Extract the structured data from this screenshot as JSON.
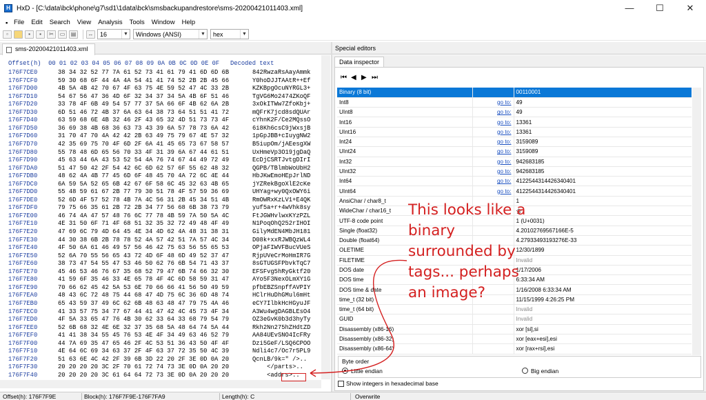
{
  "window": {
    "title": "HxD - [C:\\data\\bck\\phone\\g7\\sd1\\1data\\bck\\smsbackupandrestore\\sms-20200421011403.xml]",
    "app_icon_letter": "H",
    "minimize_glyph": "—",
    "maximize_glyph": "☐",
    "close_glyph": "✕"
  },
  "menu": [
    "File",
    "Edit",
    "Search",
    "View",
    "Analysis",
    "Tools",
    "Window",
    "Help"
  ],
  "toolbar": {
    "bytes_per_row": "16",
    "charset": "Windows (ANSI)",
    "offset_base": "hex"
  },
  "editor": {
    "tab_label": "sms-20200421011403.xml",
    "header": "Offset(h)  00 01 02 03 04 05 06 07 08 09 0A 0B 0C 0D 0E 0F   Decoded text",
    "rows": [
      {
        "offset": "176F7CE0",
        "bytes": "38 34 32 52 77 7A 61 52 73 41 61 79 41 6D 6D 6B",
        "text": "842RwzaRsAayAmmk"
      },
      {
        "offset": "176F7CF0",
        "bytes": "59 30 68 6F 44 4A 4A 54 41 41 74 52 2B 2B 45 66",
        "text": "Y0hoDJJTAAtR++Ef"
      },
      {
        "offset": "176F7D00",
        "bytes": "4B 5A 4B 42 70 67 4F 63 75 4E 59 52 47 4C 33 2B",
        "text": "KZKBpgOcuNYRGL3+"
      },
      {
        "offset": "176F7D10",
        "bytes": "54 67 56 47 36 4D 6F 32 34 37 34 5A 4B 6F 51 46",
        "text": "TgVG6Mo2474ZKoQF"
      },
      {
        "offset": "176F7D20",
        "bytes": "33 78 4F 6B 49 54 57 77 37 5A 66 6F 4B 62 6A 2B",
        "text": "3xOkITWw7ZfoKbj+"
      },
      {
        "offset": "176F7D30",
        "bytes": "6D 51 46 72 4B 37 6A 63 64 38 73 64 51 51 41 72",
        "text": "mQFrK7jcd8sdQUAr"
      },
      {
        "offset": "176F7D40",
        "bytes": "63 59 68 6E 4B 32 46 2F 43 65 32 4D 51 73 73 4F",
        "text": "cYhnK2F/Ce2MQssO"
      },
      {
        "offset": "176F7D50",
        "bytes": "36 69 38 4B 68 36 63 73 43 39 6A 57 78 73 6A 42",
        "text": "6i8Kh6csC9jWxsjB"
      },
      {
        "offset": "176F7D60",
        "bytes": "31 70 47 70 4A 42 42 2B 63 49 75 79 67 4E 57 32",
        "text": "1pGpJBB+cIuygNW2"
      },
      {
        "offset": "176F7D70",
        "bytes": "42 35 69 75 70 4F 6D 2F 6A 41 45 65 73 67 58 57",
        "text": "B5iupOm/jAEesgXW"
      },
      {
        "offset": "176F7D80",
        "bytes": "55 78 48 6D 65 56 70 33 4F 31 39 6A 67 44 61 51",
        "text": "UxHmeVp3O19jgDaQ"
      },
      {
        "offset": "176F7D90",
        "bytes": "45 63 44 6A 43 53 52 54 4A 76 74 67 44 49 72 49",
        "text": "EcDjCSRTJvtgDIrI"
      },
      {
        "offset": "176F7DA0",
        "bytes": "51 47 50 42 2F 54 42 6C 6D 62 57 6F 55 62 48 32",
        "text": "QGPB/TBlmbWoUbH2"
      },
      {
        "offset": "176F7DB0",
        "bytes": "48 62 4A 4B 77 45 6D 6F 48 45 70 4A 72 6C 4E 44",
        "text": "HbJKwEmoHEpJrlND"
      },
      {
        "offset": "176F7DC0",
        "bytes": "6A 59 5A 52 65 6B 42 67 6F 58 6C 45 32 63 4B 65",
        "text": "jYZRekBgoXlE2cKe"
      },
      {
        "offset": "176F7DD0",
        "bytes": "55 48 59 61 67 2B 77 79 30 51 78 4F 57 59 36 69",
        "text": "UHYag+wy0QxOWY6i"
      },
      {
        "offset": "176F7DE0",
        "bytes": "52 6D 4F 57 52 78 4B 7A 4C 56 31 2B 45 34 51 4B",
        "text": "RmOWRxKzLV1+E4QK"
      },
      {
        "offset": "176F7DF0",
        "bytes": "79 75 66 35 61 2B 72 2B 34 77 56 68 6B 38 73 79",
        "text": "yuf5a+r+4wVhk8sy"
      },
      {
        "offset": "176F7E00",
        "bytes": "46 74 4A 47 57 48 76 6C 77 78 4B 59 7A 50 5A 4C",
        "text": "FtJGWHvlwxKYzPZL"
      },
      {
        "offset": "176F7E10",
        "bytes": "4E 31 50 6F 71 4F 68 51 32 35 32 72 49 48 4F 49",
        "text": "N1PoqOhQ252rIHOI"
      },
      {
        "offset": "176F7E20",
        "bytes": "47 69 6C 79 4D 64 45 4E 34 4D 62 4A 48 31 38 31",
        "text": "GilyMdEN4MbJH181"
      },
      {
        "offset": "176F7E30",
        "bytes": "44 30 38 6B 2B 78 78 52 4A 57 42 51 7A 57 4C 34",
        "text": "D08k+xxRJWBQzWL4"
      },
      {
        "offset": "176F7E40",
        "bytes": "4F 50 6A 61 46 49 57 56 46 42 75 63 56 55 65 53",
        "text": "OPjaFIWVFBucVUeS"
      },
      {
        "offset": "176F7E50",
        "bytes": "52 6A 70 55 56 65 43 72 4D 6F 48 6D 49 52 37 47",
        "text": "RjpUVeCrMoHmIR7G"
      },
      {
        "offset": "176F7E60",
        "bytes": "38 73 47 54 55 47 53 46 50 62 76 6B 54 71 43 37",
        "text": "8sGTUGSFPbvkTqC7"
      },
      {
        "offset": "176F7E70",
        "bytes": "45 46 53 46 76 67 35 68 52 79 47 6B 74 66 32 30",
        "text": "EFSFvg5hRyGktf20"
      },
      {
        "offset": "176F7E80",
        "bytes": "41 59 6F 35 46 33 4E 65 78 4F 4C 6D 58 59 31 47",
        "text": "AYo5F3NexOLmXY1G"
      },
      {
        "offset": "176F7E90",
        "bytes": "70 66 62 45 42 5A 53 6E 70 66 66 41 56 50 49 59",
        "text": "pfbEBZSnpffAVPIY"
      },
      {
        "offset": "176F7EA0",
        "bytes": "48 43 6C 72 48 75 44 68 47 4D 75 6C 36 6D 48 74",
        "text": "HClrHuDhGMul6mHt"
      },
      {
        "offset": "176F7EB0",
        "bytes": "65 43 59 37 49 6C 62 6B 48 63 48 47 79 75 4A 46",
        "text": "eCY7IlbkHcHGyuJF"
      },
      {
        "offset": "176F7EC0",
        "bytes": "41 33 57 75 34 77 67 44 41 47 42 4C 45 73 4F 34",
        "text": "A3Wu4wgDAGBLEsO4"
      },
      {
        "offset": "176F7ED0",
        "bytes": "4F 5A 33 65 47 76 4B 30 62 33 64 33 68 79 54 79",
        "text": "OZ3eGvK0b3d3hyTy"
      },
      {
        "offset": "176F7EE0",
        "bytes": "52 6B 68 32 4E 6E 32 37 35 68 5A 48 64 74 5A 44",
        "text": "Rkh2Nn275hZHdtZD"
      },
      {
        "offset": "176F7EF0",
        "bytes": "41 41 38 34 55 45 76 53 4E 4F 34 49 63 46 52 79",
        "text": "AA84UEvSNO4IcFRy"
      },
      {
        "offset": "176F7F00",
        "bytes": "44 7A 69 35 47 65 46 2F 4C 53 51 36 43 50 4F 4F",
        "text": "Dzi5GeF/LSQ6CPOO"
      },
      {
        "offset": "176F7F10",
        "bytes": "4E 64 6C 69 34 63 37 2F 4F 63 37 72 35 50 4C 39",
        "text": "Ndli4c7/Oc7r5PL9"
      },
      {
        "offset": "176F7F20",
        "bytes": "51 63 6E 4C 42 2F 39 6B 3D 22 20 2F 3E 0D 0A 20",
        "text": "QcnLB/9k=\" />.. "
      },
      {
        "offset": "176F7F30",
        "bytes": "20 20 20 20 3C 2F 70 61 72 74 73 3E 0D 0A 20 20",
        "text": "    </parts>..  "
      },
      {
        "offset": "176F7F40",
        "bytes": "20 20 20 20 3C 61 64 64 72 73 3E 0D 0A 20 20 20",
        "text": "    <addrs>..   "
      }
    ]
  },
  "special_editors": {
    "header": "Special editors",
    "tab": "Data inspector",
    "goto_label": "go to:",
    "rows": [
      {
        "label": "Binary (8 bit)",
        "goto": false,
        "value": "00110001",
        "selected": true
      },
      {
        "label": "Int8",
        "goto": true,
        "value": "49"
      },
      {
        "label": "UInt8",
        "goto": true,
        "value": "49"
      },
      {
        "label": "Int16",
        "goto": true,
        "value": "13361"
      },
      {
        "label": "UInt16",
        "goto": true,
        "value": "13361"
      },
      {
        "label": "Int24",
        "goto": true,
        "value": "3159089"
      },
      {
        "label": "UInt24",
        "goto": true,
        "value": "3159089"
      },
      {
        "label": "Int32",
        "goto": true,
        "value": "942683185"
      },
      {
        "label": "UInt32",
        "goto": true,
        "value": "942683185"
      },
      {
        "label": "Int64",
        "goto": true,
        "value": "4122544314426340401"
      },
      {
        "label": "UInt64",
        "goto": true,
        "value": "4122544314426340401"
      },
      {
        "label": "AnsiChar / char8_t",
        "goto": false,
        "value": "1"
      },
      {
        "label": "WideChar / char16_t",
        "goto": false,
        "value": "㐱"
      },
      {
        "label": "UTF-8 code point",
        "goto": false,
        "value": "1 (U+0031)"
      },
      {
        "label": "Single (float32)",
        "goto": false,
        "value": "4.20102769567166E-5"
      },
      {
        "label": "Double (float64)",
        "goto": false,
        "value": "4.27933493193276E-33"
      },
      {
        "label": "OLETIME",
        "goto": false,
        "value": "12/30/1899"
      },
      {
        "label": "FILETIME",
        "goto": false,
        "value": "Invalid",
        "invalid": true
      },
      {
        "label": "DOS date",
        "goto": false,
        "value": "1/17/2006"
      },
      {
        "label": "DOS time",
        "goto": false,
        "value": "6:33:34 AM"
      },
      {
        "label": "DOS time & date",
        "goto": false,
        "value": "1/16/2008 6:33:34 AM"
      },
      {
        "label": "time_t (32 bit)",
        "goto": false,
        "value": "11/15/1999 4:26:25 PM"
      },
      {
        "label": "time_t (64 bit)",
        "goto": false,
        "value": "Invalid",
        "invalid": true
      },
      {
        "label": "GUID",
        "goto": false,
        "value": "Invalid",
        "invalid": true
      },
      {
        "label": "Disassembly (x86-16)",
        "goto": false,
        "value": "xor [si],si"
      },
      {
        "label": "Disassembly (x86-32)",
        "goto": false,
        "value": "xor [eax+esi],esi"
      },
      {
        "label": "Disassembly (x86-64)",
        "goto": false,
        "value": "xor [rax+rsi],esi"
      }
    ],
    "byte_order_title": "Byte order",
    "little_endian": "Little endian",
    "big_endian": "Big endian",
    "show_hex_label": "Show integers in hexadecimal base"
  },
  "annotation": {
    "text": "This looks like a binary surrounded by tags... perhaps an image?",
    "color": "#d42020"
  },
  "statusbar": {
    "offset": "Offset(h): 176F7F9E",
    "block": "Block(h): 176F7F9E-176F7FA9",
    "length": "Length(h): C",
    "mode": "Overwrite"
  }
}
